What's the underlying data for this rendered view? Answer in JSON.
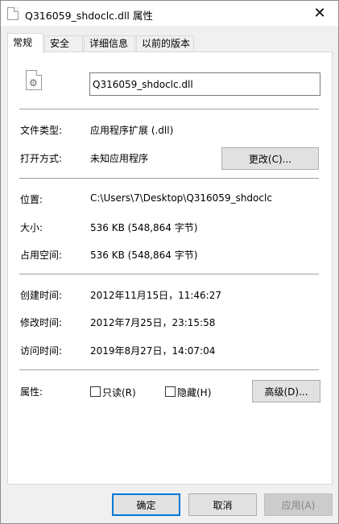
{
  "window": {
    "title": "Q316059_shdoclc.dll 属性",
    "close_glyph": "✕"
  },
  "tabs": [
    {
      "label": "常规",
      "active": true
    },
    {
      "label": "安全",
      "active": false
    },
    {
      "label": "详细信息",
      "active": false
    },
    {
      "label": "以前的版本",
      "active": false
    }
  ],
  "general": {
    "file_name": "Q316059_shdoclc.dll",
    "file_type_label": "文件类型:",
    "file_type_value": "应用程序扩展 (.dll)",
    "opens_with_label": "打开方式:",
    "opens_with_value": "未知应用程序",
    "change_button": "更改(C)...",
    "location_label": "位置:",
    "location_value": "C:\\Users\\7\\Desktop\\Q316059_shdoclc",
    "size_label": "大小:",
    "size_value": "536 KB (548,864 字节)",
    "size_on_disk_label": "占用空间:",
    "size_on_disk_value": "536 KB (548,864 字节)",
    "created_label": "创建时间:",
    "created_value": "2012年11月15日，11:46:27",
    "modified_label": "修改时间:",
    "modified_value": "2012年7月25日，23:15:58",
    "accessed_label": "访问时间:",
    "accessed_value": "2019年8月27日，14:07:04",
    "attributes_label": "属性:",
    "readonly_label": "只读(R)",
    "readonly_checked": false,
    "hidden_label": "隐藏(H)",
    "hidden_checked": false,
    "advanced_button": "高级(D)..."
  },
  "footer": {
    "ok": "确定",
    "cancel": "取消",
    "apply": "应用(A)"
  }
}
